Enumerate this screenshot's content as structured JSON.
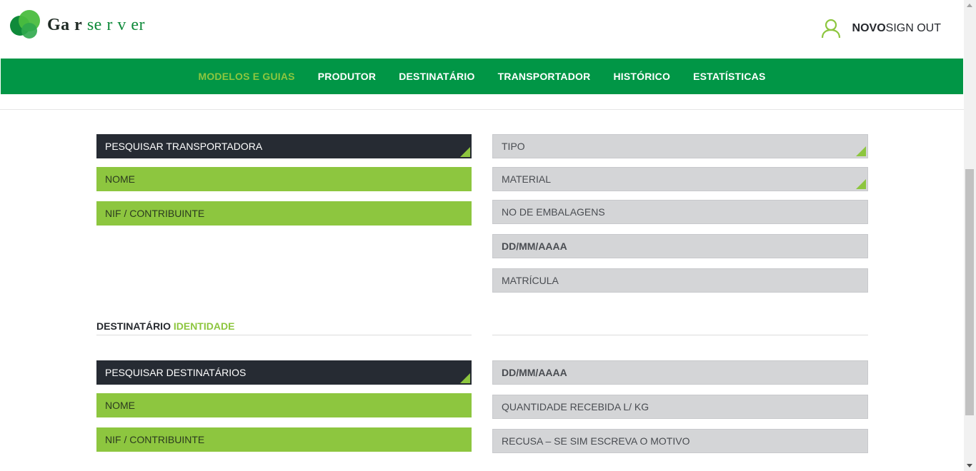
{
  "header": {
    "brand_part1": "Ga r",
    "brand_part2": " se r v er",
    "user_new": "NOVO",
    "user_signout": "SIGN OUT"
  },
  "nav": {
    "items": [
      {
        "label": "MODELOS E GUIAS",
        "active": true
      },
      {
        "label": "PRODUTOR"
      },
      {
        "label": "DESTINATÁRIO"
      },
      {
        "label": "TRANSPORTADOR"
      },
      {
        "label": "HISTÓRICO"
      },
      {
        "label": "ESTATÍSTICAS"
      }
    ]
  },
  "transport": {
    "search": "PESQUISAR TRANSPORTADORA",
    "name": "NOME",
    "nif": "NIF / CONTRIBUINTE",
    "tipo": "TIPO",
    "material": "MATERIAL",
    "embalagens": "NO DE EMBALAGENS",
    "date": "DD/MM/AAAA",
    "matricula": "MATRÍCULA"
  },
  "destinatario": {
    "title_part1": "DESTINATÁRIO",
    "title_part2": "IDENTIDADE",
    "search": "PESQUISAR DESTINATÁRIOS",
    "name": "NOME",
    "nif": "NIF / CONTRIBUINTE",
    "date": "DD/MM/AAAA",
    "quantidade": "QUANTIDADE RECEBIDA L/ KG",
    "recusa": "RECUSA – SE SIM ESCREVA O MOTIVO"
  },
  "colors": {
    "primary_green": "#019646",
    "accent_green": "#8dc63f",
    "dark": "#262b33",
    "field_gray": "#d4d5d7"
  }
}
